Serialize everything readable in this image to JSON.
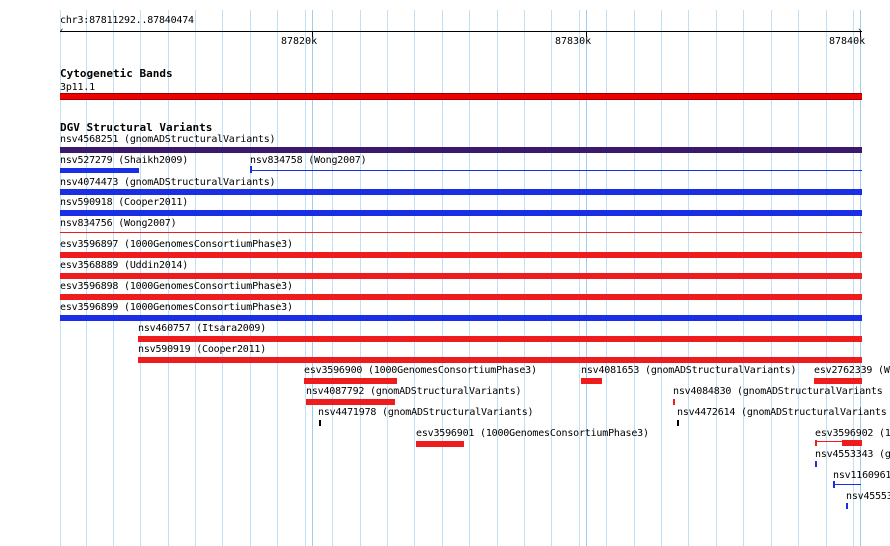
{
  "ruler": {
    "location": "chr3:87811292..87840474",
    "tick_labels": [
      "87820k",
      "87830k",
      "87840k"
    ]
  },
  "tracks": {
    "cytoband_title": "Cytogenetic Bands",
    "cytoband_label": "3p11.1",
    "dgv_title": "DGV Structural Variants"
  },
  "features": [
    {
      "label": "nsv4568251 (gnomADStructuralVariants)",
      "color": "#3b1a6e"
    },
    {
      "label": "nsv527279 (Shaikh2009)",
      "color": "#1a2ee6"
    },
    {
      "label": "nsv834758 (Wong2007)",
      "color": "#1a2ee6"
    },
    {
      "label": "nsv4074473 (gnomADStructuralVariants)",
      "color": "#1a2ee6"
    },
    {
      "label": "nsv590918 (Cooper2011)",
      "color": "#1a2ee6"
    },
    {
      "label": "nsv834756 (Wong2007)",
      "color": "#ee1c1c"
    },
    {
      "label": "esv3596897 (1000GenomesConsortiumPhase3)",
      "color": "#ee1c1c"
    },
    {
      "label": "esv3568889 (Uddin2014)",
      "color": "#ee1c1c"
    },
    {
      "label": "esv3596898 (1000GenomesConsortiumPhase3)",
      "color": "#ee1c1c"
    },
    {
      "label": "esv3596899 (1000GenomesConsortiumPhase3)",
      "color": "#1a2ee6"
    },
    {
      "label": "nsv460757 (Itsara2009)",
      "color": "#ee1c1c"
    },
    {
      "label": "nsv590919 (Cooper2011)",
      "color": "#ee1c1c"
    },
    {
      "label": "esv3596900 (1000GenomesConsortiumPhase3)",
      "color": "#ee1c1c"
    },
    {
      "label": "nsv4081653 (gnomADStructuralVariants)",
      "color": "#ee1c1c"
    },
    {
      "label": "esv2762339 (W",
      "color": "#ee1c1c"
    },
    {
      "label": "nsv4087792 (gnomADStructuralVariants)",
      "color": "#ee1c1c"
    },
    {
      "label": "nsv4084830 (gnomADStructuralVariants",
      "color": "#ee1c1c"
    },
    {
      "label": "nsv4471978 (gnomADStructuralVariants)",
      "color": "#000000"
    },
    {
      "label": "nsv4472614 (gnomADStructuralVariants",
      "color": "#000000"
    },
    {
      "label": "esv3596901 (1000GenomesConsortiumPhase3)",
      "color": "#ee1c1c"
    },
    {
      "label": "esv3596902 (1",
      "color": "#ee1c1c"
    },
    {
      "label": "nsv4553343 (g",
      "color": "#1a2ee6"
    },
    {
      "label": "nsv1160961",
      "color": "#1a2ee6"
    },
    {
      "label": "nsv45553",
      "color": "#1a2ee6"
    }
  ]
}
